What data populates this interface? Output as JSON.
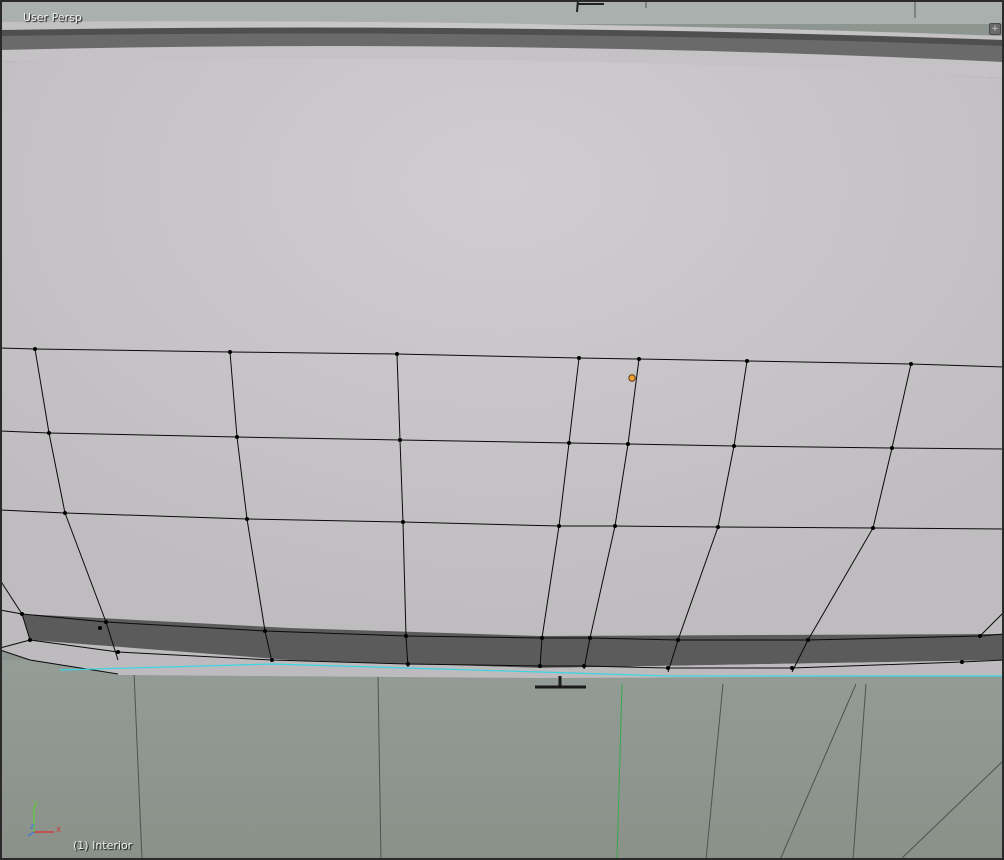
{
  "viewport": {
    "view_name": "User Persp",
    "object_info": "(1) Interior",
    "corner_widget_icon": "plus-icon"
  },
  "axes": {
    "x_label": "x",
    "y_label": "y",
    "z_label": "z",
    "x_color": "#d23c3c",
    "y_color": "#6ac24a",
    "z_color": "#4a7cd2"
  },
  "colors": {
    "surface": "#c9c7c9",
    "floor": "#8d9590",
    "rim": "#5a5a5a",
    "wire": "#000000",
    "active_vertex": "#f0a030",
    "selected_edge": "#39d6e6"
  }
}
